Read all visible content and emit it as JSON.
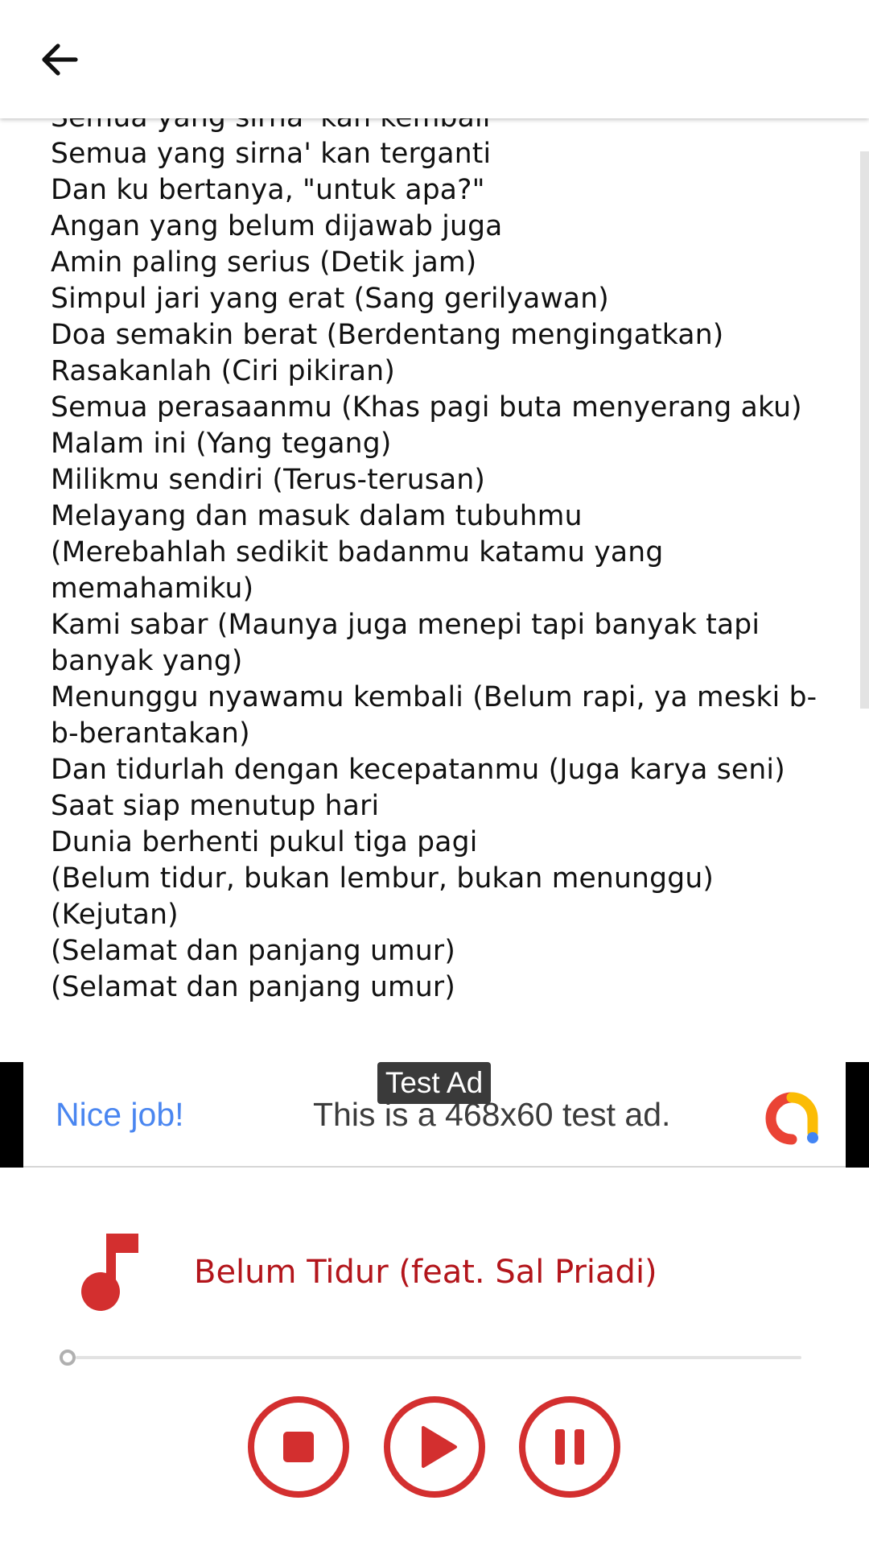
{
  "header": {
    "back_icon": "arrow-left-icon"
  },
  "lyrics": [
    "Semua yang sirna' kan kembali",
    "Semua yang sirna' kan terganti",
    "Dan ku bertanya, \"untuk apa?\"",
    "Angan yang belum dijawab juga",
    "Amin paling serius (Detik jam)",
    "Simpul jari yang erat (Sang gerilyawan)",
    "Doa semakin berat (Berdentang mengingatkan)",
    "Rasakanlah (Ciri pikiran)",
    "Semua perasaanmu (Khas pagi buta menyerang aku)",
    "Malam ini (Yang tegang)",
    "Milikmu sendiri (Terus-terusan)",
    "Melayang dan masuk dalam tubuhmu",
    "(Merebahlah sedikit badanmu katamu yang memahamiku)",
    "Kami sabar (Maunya juga menepi tapi banyak tapi banyak yang)",
    "Menunggu nyawamu kembali (Belum rapi, ya meski b-b-berantakan)",
    "Dan tidurlah dengan kecepatanmu (Juga karya seni)",
    "Saat siap menutup hari",
    "Dunia berhenti pukul tiga pagi",
    "(Belum tidur, bukan lembur, bukan menunggu)",
    "(Kejutan)",
    "(Selamat dan panjang umur)",
    "(Selamat dan panjang umur)"
  ],
  "ad": {
    "label": "Test Ad",
    "headline": "Nice job!",
    "text": "This is a 468x60 test ad.",
    "logo_icon": "admob-logo-icon"
  },
  "player": {
    "track_title": "Belum Tidur (feat. Sal Priadi)",
    "progress": 0,
    "music_icon": "music-note-icon",
    "controls": {
      "stop": "stop-icon",
      "play": "play-icon",
      "pause": "pause-icon"
    }
  },
  "colors": {
    "accent": "#d32f2f",
    "title": "#b3151b",
    "ad_blue": "#4a86f0",
    "ad_yellow": "#fbbc05",
    "ad_red": "#ea4335"
  }
}
